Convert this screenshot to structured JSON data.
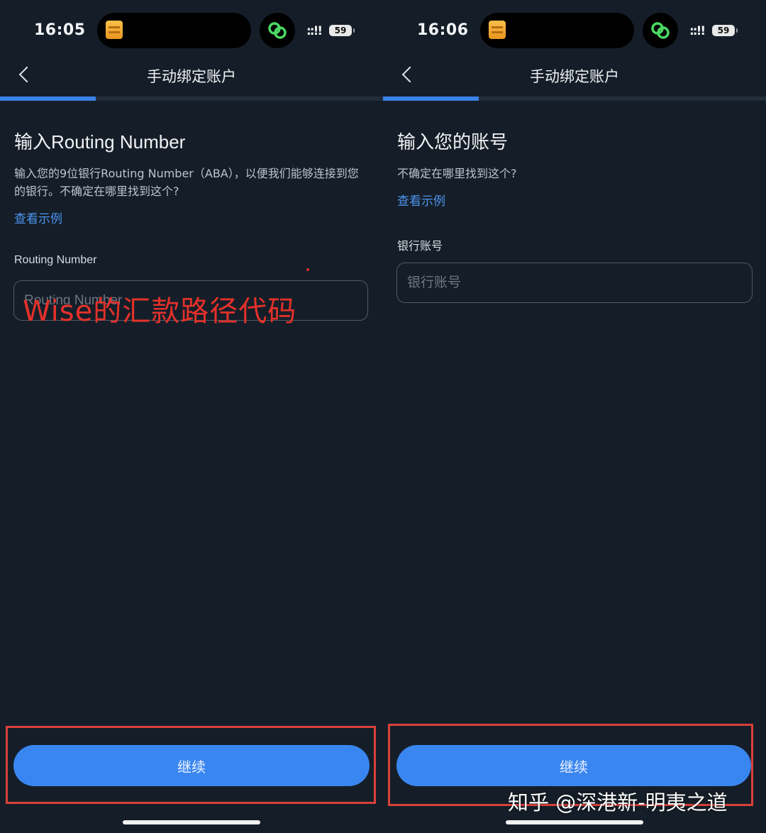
{
  "left_screen": {
    "status": {
      "time": "16:05",
      "signal": "::!!",
      "battery": "59"
    },
    "nav": {
      "title": "手动绑定账户"
    },
    "progress": 0.25,
    "heading": "输入Routing Number",
    "description": "输入您的9位银行Routing Number（ABA），以便我们能够连接到您的银行。不确定在哪里找到这个?",
    "example_link": "查看示例",
    "field_label": "Routing Number",
    "input": {
      "placeholder": "Routing Number",
      "value": ""
    },
    "overlay_annotation": "Wise的汇款路径代码",
    "continue_label": "继续"
  },
  "right_screen": {
    "status": {
      "time": "16:06",
      "signal": "::!!",
      "battery": "59"
    },
    "nav": {
      "title": "手动绑定账户"
    },
    "progress": 0.25,
    "heading": "输入您的账号",
    "description": "不确定在哪里找到这个?",
    "example_link": "查看示例",
    "field_label": "银行账号",
    "input": {
      "placeholder": "银行账号",
      "value": ""
    },
    "continue_label": "继续"
  },
  "watermark": "知乎 @深港新-明夷之道",
  "colors": {
    "background": "#151e28",
    "accent": "#3a86f0",
    "link": "#4d94f0",
    "annotation_red": "#e5312a",
    "live_activity_green": "#4cd964"
  },
  "icons": {
    "back": "chevron-left-icon",
    "live_activity_app": "app-icon",
    "live_activity_link": "link-icon"
  }
}
